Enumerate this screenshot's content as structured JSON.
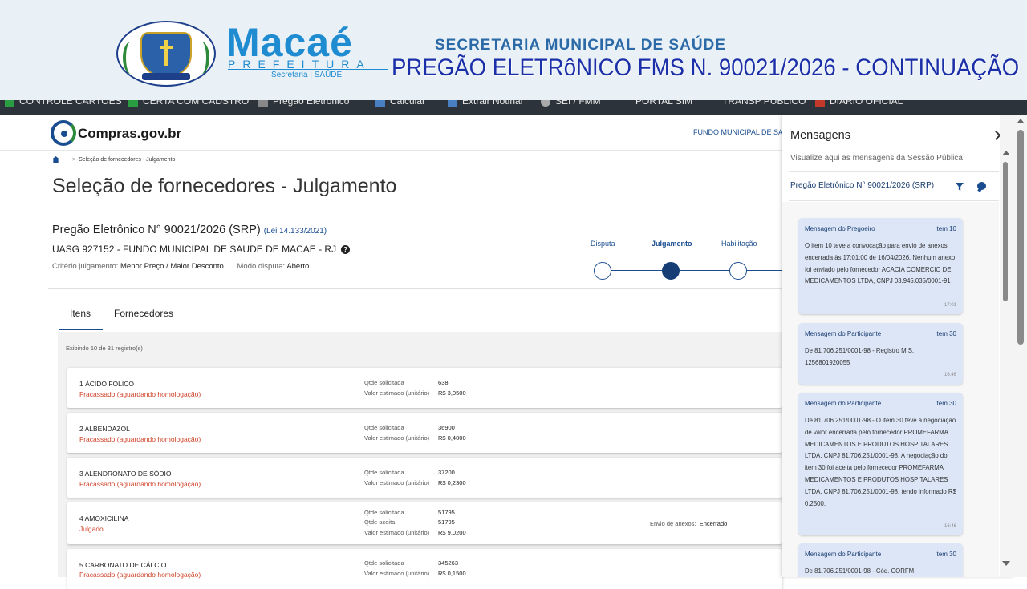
{
  "banner": {
    "logo_name": "Macaé",
    "logo_sub": "PREFEITURA",
    "logo_secretaria": "Secretaria | SAÚDE",
    "secretaria_title": "SECRETARIA MUNICIPAL DE SAÚDE",
    "pregao_title": "PREGÃO ELETRôNICO FMS N. 90021/2026 - CONTINUAÇÃO"
  },
  "bookmarks": [
    {
      "label": "CONTROLE CARTOES"
    },
    {
      "label": "CERTA COM CADSTRO"
    },
    {
      "label": "Pregão Eletrônico"
    },
    {
      "label": "Calcular"
    },
    {
      "label": "Extrair Notinal"
    },
    {
      "label": "SEI / FMM"
    },
    {
      "label": "PORTAL SIM"
    },
    {
      "label": "TRANSP PUBLICO"
    },
    {
      "label": "DIARIO OFICIAL"
    }
  ],
  "header": {
    "site_name": "Compras.gov.br",
    "org_link": "FUNDO MUNICIPAL DE SAÚDE"
  },
  "breadcrumb": {
    "current": "Seleção de fornecedores - Julgamento"
  },
  "page": {
    "title": "Seleção de fornecedores - Julgamento",
    "process_title": "Pregão Eletrônico N° 90021/2026 (SRP)",
    "law": "(Lei 14.133/2021)",
    "uasg": "UASG 927152 - FUNDO MUNICIPAL DE SAUDE DE MACAE - RJ",
    "criteria_label": "Critério julgamento:",
    "criteria_value": "Menor Preço / Maior Desconto",
    "mode_label": "Modo disputa:",
    "mode_value": "Aberto"
  },
  "stepper": {
    "steps": [
      {
        "label": "Disputa",
        "state": "done"
      },
      {
        "label": "Julgamento",
        "state": "active"
      },
      {
        "label": "Habilitação",
        "state": "pending"
      }
    ]
  },
  "tabs": [
    {
      "label": "Itens",
      "active": true
    },
    {
      "label": "Fornecedores",
      "active": false
    }
  ],
  "list": {
    "count_text": "Exibindo 10 de 31 registro(s)",
    "qty_label": "Qtde solicitada",
    "accepted_label": "Qtde aceita",
    "estimated_label": "Valor estimado (unitário)",
    "items": [
      {
        "name": "1   ÁCIDO FÓLICO",
        "status": "Fracassado (aguardando homologação)",
        "qty": "638",
        "estimated": "R$ 3,0500"
      },
      {
        "name": "2   ALBENDAZOL",
        "status": "Fracassado (aguardando homologação)",
        "qty": "36900",
        "estimated": "R$ 0,4000"
      },
      {
        "name": "3   ALENDRONATO DE SÓDIO",
        "status": "Fracassado (aguardando homologação)",
        "qty": "37200",
        "estimated": "R$ 0,2300"
      },
      {
        "name": "4   AMOXICILINA",
        "status": "Julgado",
        "qty": "51795",
        "accepted": "51795",
        "estimated": "R$ 9,0200",
        "attachments_label": "Envio de anexos:",
        "attachments_value": "Encerrado"
      },
      {
        "name": "5   CARBONATO DE CÁLCIO",
        "status": "Fracassado (aguardando homologação)",
        "qty": "345263",
        "estimated": "R$ 0,1500"
      }
    ]
  },
  "messages_panel": {
    "title": "Mensagens",
    "subtitle": "Visualize aqui as mensagens da Sessão Pública",
    "pregao": "Pregão Eletrônico N° 90021/2026 (SRP)",
    "messages": [
      {
        "from": "Mensagem do Pregoeiro",
        "item": "Item 10",
        "text": "O item 10 teve a convocação para envio de anexos encerrada às 17:01:00 de 16/04/2026. Nenhum anexo foi enviado pelo fornecedor ACACIA COMERCIO DE MEDICAMENTOS LTDA, CNPJ 03.945.035/0001-91",
        "time": "17:01"
      },
      {
        "from": "Mensagem do Participante",
        "item": "Item 30",
        "text": "De 81.706.251/0001-98 - Registro M.S. 1256801920055",
        "time": "16:46"
      },
      {
        "from": "Mensagem do Participante",
        "item": "Item 30",
        "text": "De 81.706.251/0001-98 - O item 30 teve a negociação de valor encerrada pelo fornecedor PROMEFARMA MEDICAMENTOS E PRODUTOS HOSPITALARES LTDA, CNPJ 81.706.251/0001-98. A negociação do item 30 foi aceita pelo fornecedor PROMEFARMA MEDICAMENTOS E PRODUTOS HOSPITALARES LTDA, CNPJ 81.706.251/0001-98, tendo informado R$ 0,2500.",
        "time": "16:46"
      },
      {
        "from": "Mensagem do Participante",
        "item": "Item 30",
        "text": "De 81.706.251/0001-98 - Cód. CORFM",
        "time": ""
      }
    ]
  },
  "colors": {
    "primary": "#1a4d8f",
    "status_red": "#d0432b",
    "message_bg": "#dce6f7"
  }
}
